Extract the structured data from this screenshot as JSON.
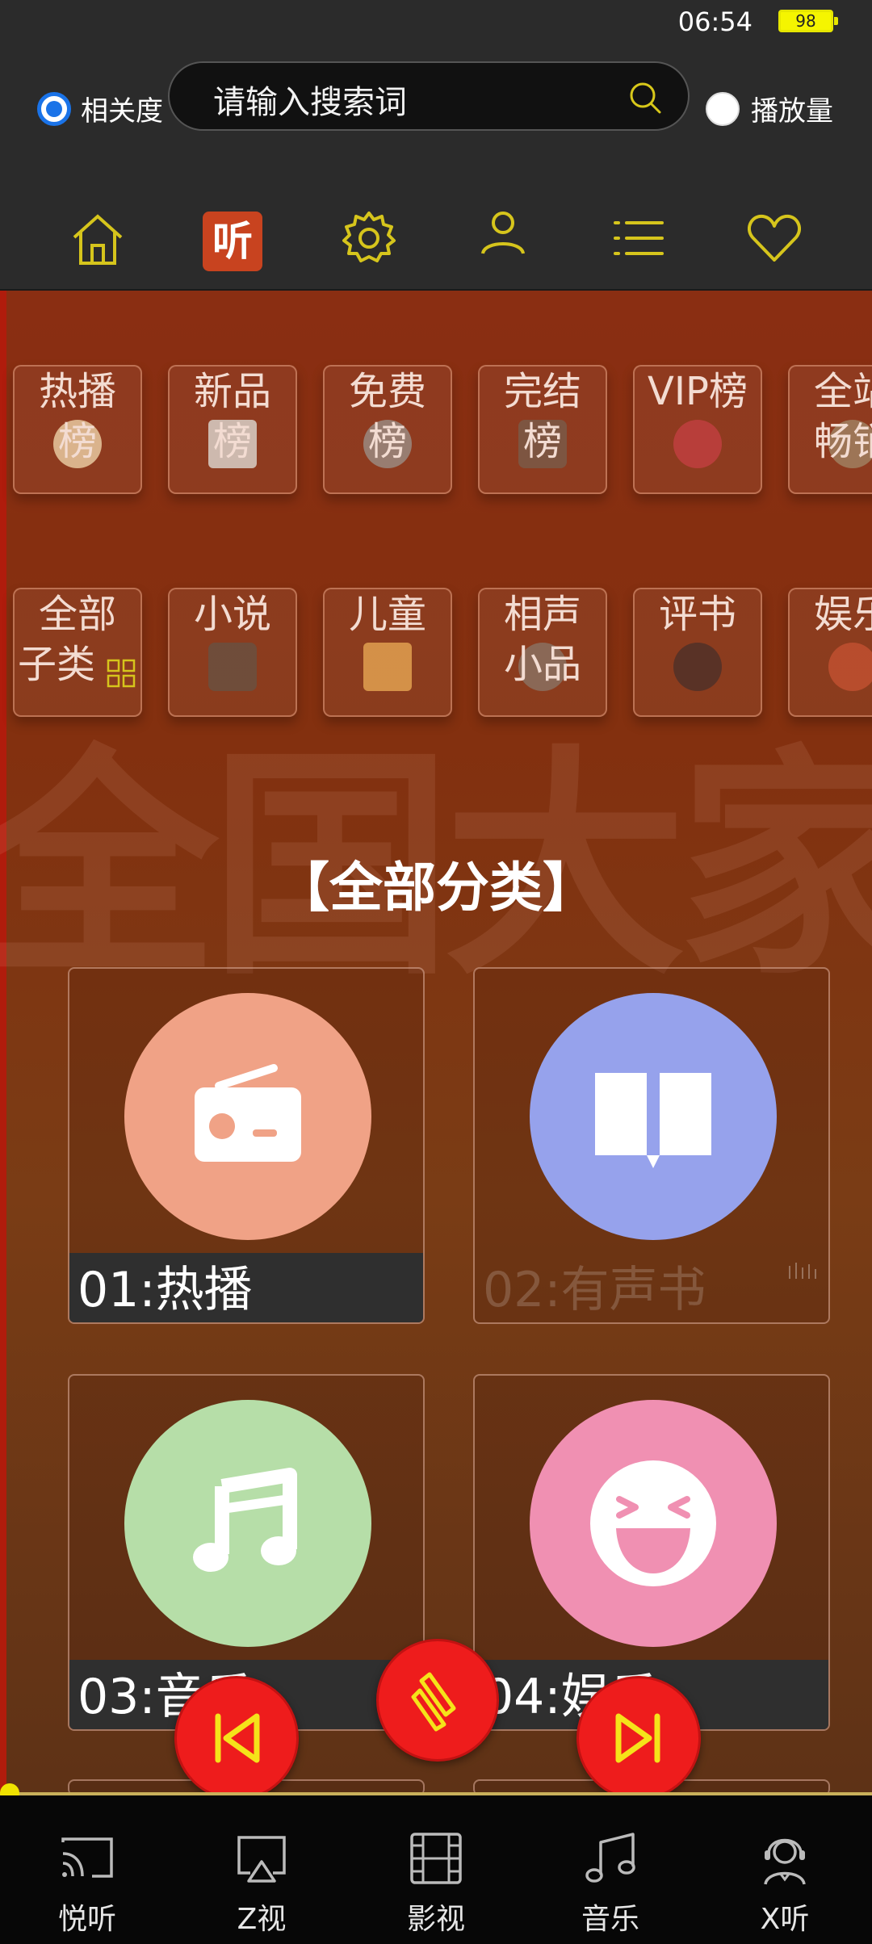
{
  "status": {
    "time": "06:54",
    "battery": "98"
  },
  "search": {
    "sort_relevance": "相关度",
    "sort_plays": "播放量",
    "placeholder": "请输入搜索词"
  },
  "topnav": {
    "ting_label": "听"
  },
  "chips_row1": [
    "热播",
    "新品",
    "免费",
    "完结",
    "VIP榜",
    "全站"
  ],
  "chips_row1_sub": [
    "榜",
    "榜",
    "榜",
    "榜",
    "",
    "畅销"
  ],
  "chips_row2": [
    "全部",
    "小说",
    "儿童",
    "相声",
    "评书",
    "娱乐"
  ],
  "chips_row2_sub": [
    "子类",
    "",
    "",
    "小品",
    "",
    ""
  ],
  "section_title": "【全部分类】",
  "categories": [
    {
      "label": "01:热播",
      "color": "#f0a286"
    },
    {
      "label": "02:有声书",
      "color": "#96a2ec"
    },
    {
      "label": "03:音乐",
      "color": "#b6dea8"
    },
    {
      "label": "04:娱乐",
      "color": "#f090b2"
    }
  ],
  "bottom_nav": [
    "悦听",
    "Z视",
    "影视",
    "音乐",
    "X听"
  ],
  "colors": {
    "accent_yellow": "#e6d21a",
    "fab_red": "#ee1c1c",
    "topbar": "#2b2b2b"
  }
}
